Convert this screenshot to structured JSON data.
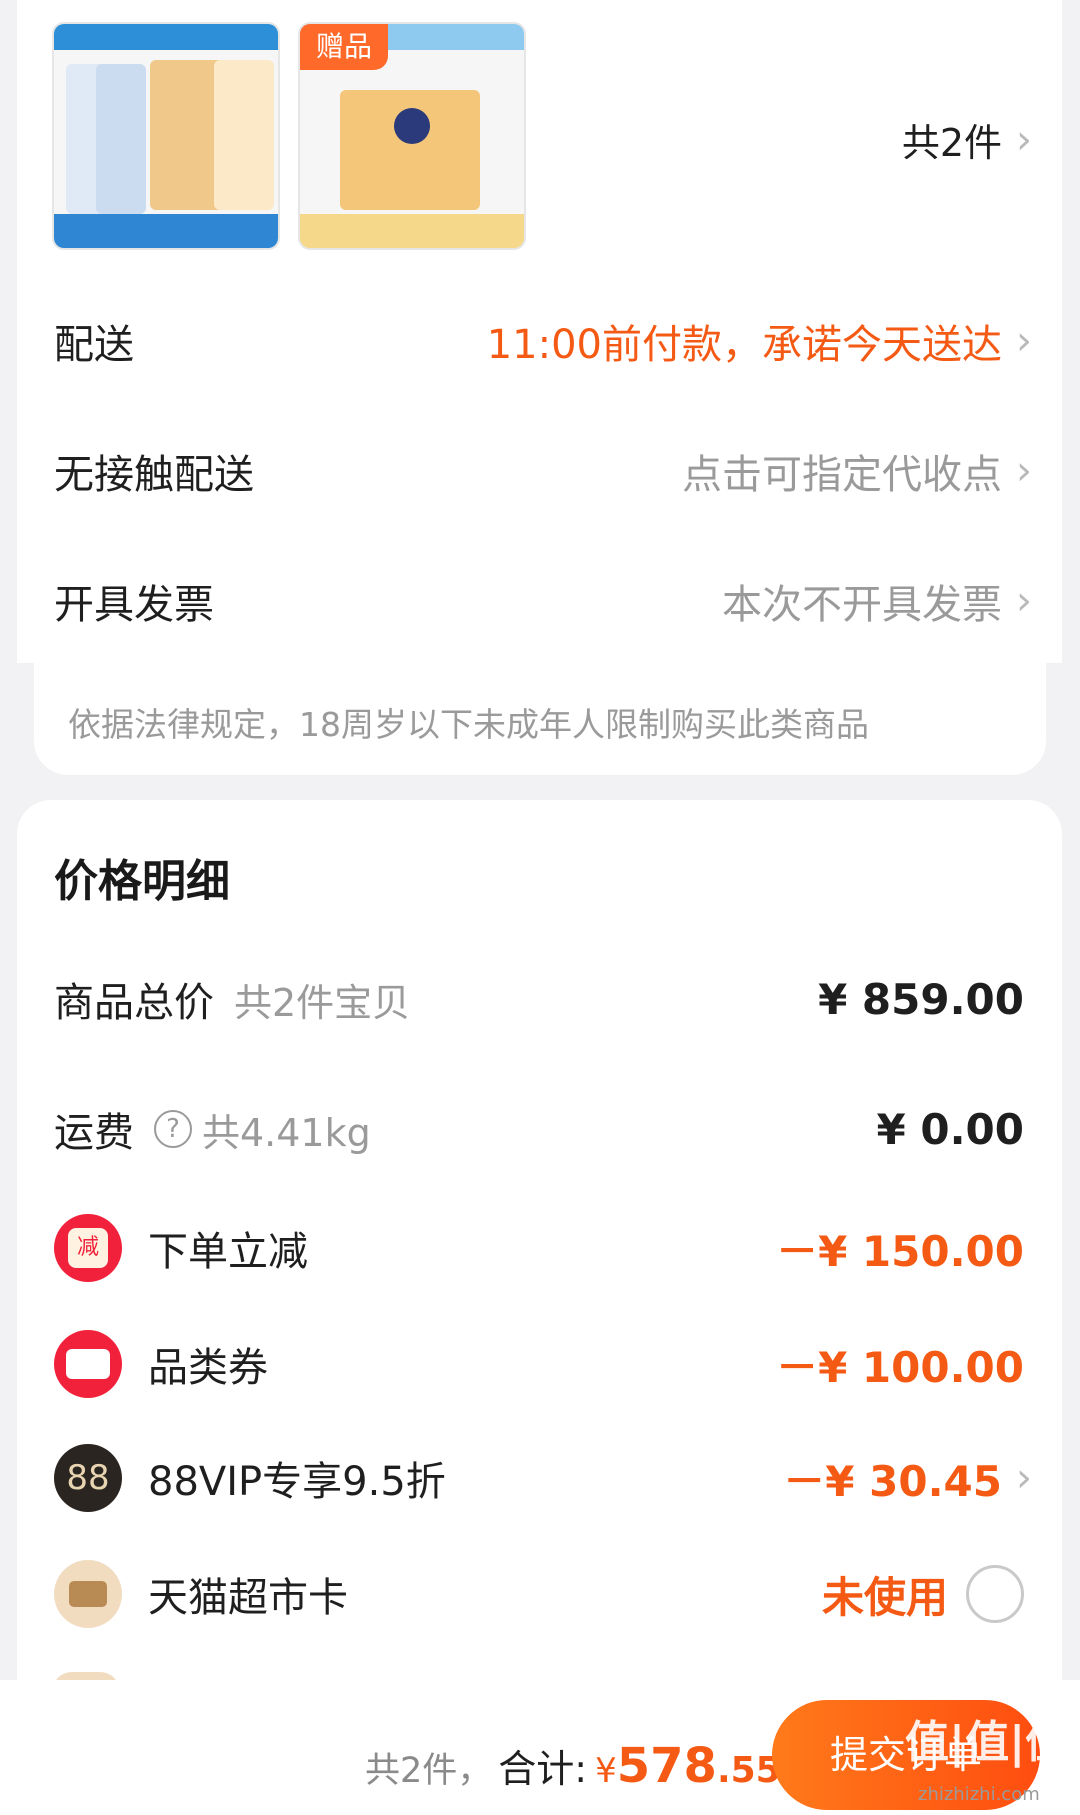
{
  "order": {
    "count_text": "共2件",
    "gift_tag": "赠品",
    "rows": [
      {
        "label": "配送",
        "value": "11:00前付款，承诺今天送达"
      },
      {
        "label": "无接触配送",
        "value": "点击可指定代收点"
      },
      {
        "label": "开具发票",
        "value": "本次不开具发票"
      }
    ],
    "legal_notice": "依据法律规定，18周岁以下未成年人限制购买此类商品"
  },
  "price_detail": {
    "title": "价格明细",
    "goods_total": {
      "label": "商品总价",
      "sub": "共2件宝贝",
      "amount": "¥ 859.00"
    },
    "shipping": {
      "label": "运费",
      "help": "?",
      "sub": "共4.41kg",
      "amount": "¥ 0.00"
    },
    "discounts": [
      {
        "icon": "reduce-icon",
        "icon_text": "减",
        "label": "下单立减",
        "amount": "－¥ 150.00"
      },
      {
        "icon": "coupon-icon",
        "label": "品类券",
        "amount": "－¥ 100.00"
      },
      {
        "icon": "88vip-icon",
        "icon_text": "88",
        "label": "88VIP专享9.5折",
        "amount": "－¥ 30.45"
      },
      {
        "icon": "card-icon",
        "label": "天猫超市卡",
        "amount": "未使用"
      }
    ]
  },
  "footer": {
    "count": "共2件，",
    "total_label": "合计:",
    "currency": "¥",
    "total_int": "578",
    "total_dec": ".55",
    "submit_label": "提交订单"
  },
  "watermark": {
    "text": "值|值|值",
    "url": "zhizhizhi.com"
  },
  "colors": {
    "accent": "#f45a14",
    "button": "#ff5a14",
    "badge_red": "#f2213b"
  }
}
